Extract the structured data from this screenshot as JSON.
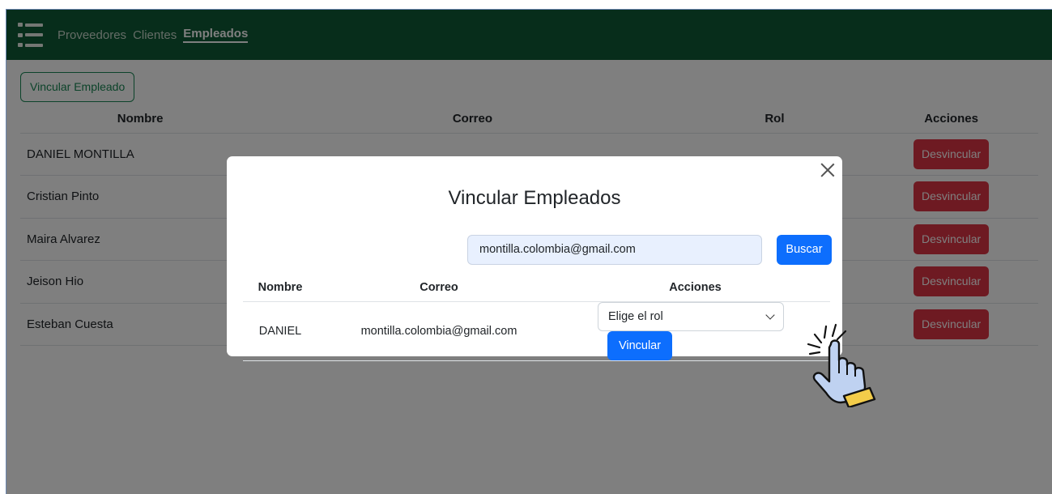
{
  "nav": {
    "items": [
      {
        "label": "Proveedores"
      },
      {
        "label": "Clientes"
      },
      {
        "label": "Empleados",
        "active": true
      }
    ]
  },
  "toolbar": {
    "vincular_label": "Vincular Empleado"
  },
  "table": {
    "headers": [
      "Nombre",
      "Correo",
      "Rol",
      "Acciones"
    ],
    "rows": [
      {
        "nombre": "DANIEL MONTILLA",
        "action": "Desvincular"
      },
      {
        "nombre": "Cristian Pinto",
        "action": "Desvincular"
      },
      {
        "nombre": "Maira Alvarez",
        "action": "Desvincular"
      },
      {
        "nombre": "Jeison Hio",
        "action": "Desvincular"
      },
      {
        "nombre": "Esteban Cuesta",
        "action": "Desvincular"
      }
    ]
  },
  "modal": {
    "title": "Vincular Empleados",
    "search_value": "montilla.colombia@gmail.com",
    "search_button": "Buscar",
    "headers": [
      "Nombre",
      "Correo",
      "Acciones"
    ],
    "result": {
      "nombre": "DANIEL",
      "correo": "montilla.colombia@gmail.com",
      "select_value": "Elige el rol",
      "vincular_label": "Vincular"
    }
  },
  "colors": {
    "navbar": "#0f5a36",
    "primary": "#0d6efd",
    "danger": "#dc3545",
    "success_outline": "#198754"
  }
}
